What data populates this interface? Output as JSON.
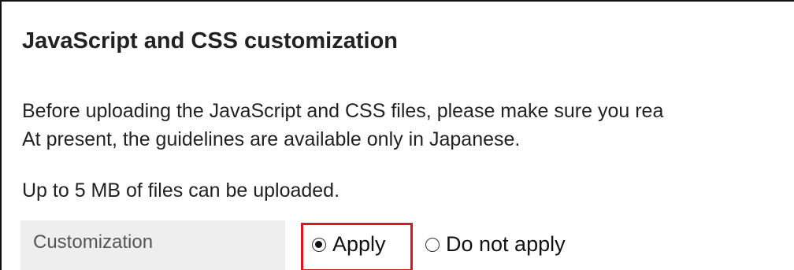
{
  "section": {
    "title": "JavaScript and CSS customization",
    "description_lines": [
      "Before uploading the JavaScript and CSS files, please make sure you rea",
      "At present, the guidelines are available only in Japanese."
    ],
    "upload_limit": "Up to 5 MB of files can be uploaded."
  },
  "customization": {
    "label": "Customization",
    "options": [
      {
        "label": "Apply",
        "selected": true,
        "highlighted": true
      },
      {
        "label": "Do not apply",
        "selected": false,
        "highlighted": false
      }
    ]
  },
  "colors": {
    "highlight_border": "#e0161e",
    "label_background": "#eeeeee"
  }
}
